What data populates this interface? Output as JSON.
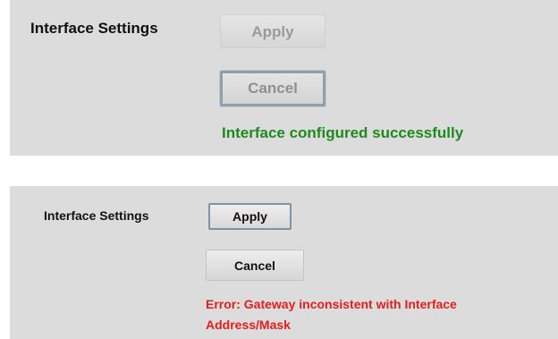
{
  "success_panel": {
    "label": "Interface Settings",
    "apply_label": "Apply",
    "cancel_label": "Cancel",
    "message": "Interface configured successfully",
    "message_color": "#1e8a1e"
  },
  "error_panel": {
    "label": "Interface Settings",
    "apply_label": "Apply",
    "cancel_label": "Cancel",
    "message_lines": [
      "Error: Gateway inconsistent with Interface",
      "Address/Mask"
    ],
    "message_color": "#e31e1e"
  },
  "colors": {
    "panel_background": "#dcdcdc",
    "focus_border": "#8ea0ad"
  }
}
